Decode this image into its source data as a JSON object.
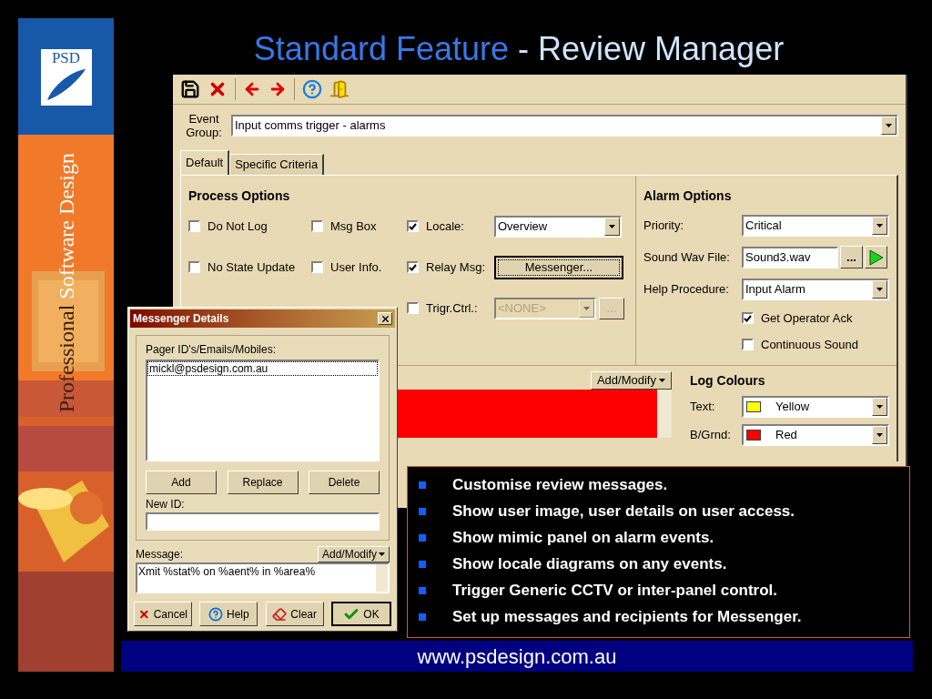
{
  "title": {
    "lead": "Standard Feature",
    "tail": "- Review Manager"
  },
  "banner": {
    "logo": "PSD",
    "tagline_lead": "Professional",
    "tagline_rest": "Software Design"
  },
  "review_manager": {
    "event_group": {
      "label": "Event Group:",
      "value": "Input comms trigger - alarms"
    },
    "tabs": [
      {
        "label": "Default",
        "selected": true
      },
      {
        "label": "Specific Criteria",
        "selected": false
      }
    ],
    "process_options": {
      "title": "Process Options",
      "rows": [
        {
          "items": [
            {
              "label": "Do Not Log",
              "checked": false
            },
            {
              "label": "Msg Box",
              "checked": false
            },
            {
              "label": "Locale:",
              "checked": true
            }
          ],
          "control": {
            "kind": "dropdown",
            "value": "Overview",
            "disabled": false
          }
        },
        {
          "items": [
            {
              "label": "No State Update",
              "checked": false
            },
            {
              "label": "User Info.",
              "checked": false
            },
            {
              "label": "Relay Msg:",
              "checked": true
            }
          ],
          "control": {
            "kind": "button",
            "label": "Messenger...",
            "disabled": false
          }
        },
        {
          "items": [
            {
              "label": "Trigr.Ctrl.:",
              "checked": false
            }
          ],
          "control": {
            "kind": "dropdown",
            "value": "<NONE>",
            "disabled": true,
            "button": "..."
          }
        }
      ]
    },
    "alarm_options": {
      "title": "Alarm Options",
      "priority": {
        "label": "Priority:",
        "value": "Critical"
      },
      "sound": {
        "label": "Sound Wav File:",
        "value": "Sound3.wav",
        "browse": "..."
      },
      "help": {
        "label": "Help Procedure:",
        "value": "Input Alarm"
      },
      "checkboxes": [
        {
          "label": "Get Operator Ack",
          "checked": true
        },
        {
          "label": "Continuous Sound",
          "checked": false
        }
      ]
    },
    "log_preview": {
      "add_modify": "Add/Modify"
    },
    "log_colours": {
      "title": "Log Colours",
      "rows": [
        {
          "label": "Text:",
          "value": "Yellow",
          "color": "#ffff00"
        },
        {
          "label": "B/Grnd:",
          "value": "Red",
          "color": "#ff0000"
        }
      ]
    }
  },
  "messenger": {
    "title": "Messenger Details",
    "ids_label": "Pager ID's/Emails/Mobiles:",
    "ids": [
      {
        "text": "mickl@psdesign.com.au",
        "selected": true
      }
    ],
    "id_buttons": [
      "Add",
      "Replace",
      "Delete"
    ],
    "new_id_label": "New ID:",
    "message_label": "Message:",
    "add_modify": "Add/Modify",
    "message": "Xmit %stat% on %aent% in %area%",
    "buttons": [
      {
        "kind": "cancel",
        "label": "Cancel"
      },
      {
        "kind": "help",
        "label": "Help"
      },
      {
        "kind": "clear",
        "label": "Clear"
      },
      {
        "kind": "ok",
        "label": "OK"
      }
    ]
  },
  "bullets": [
    "Customise review messages.",
    "Show user image, user details on user access.",
    "Show mimic panel on alarm events.",
    "Show locale diagrams on any events.",
    "Trigger Generic CCTV or inter-panel control.",
    "Set up messages and recipients for Messenger."
  ],
  "footer": {
    "url": "www.psdesign.com.au"
  }
}
